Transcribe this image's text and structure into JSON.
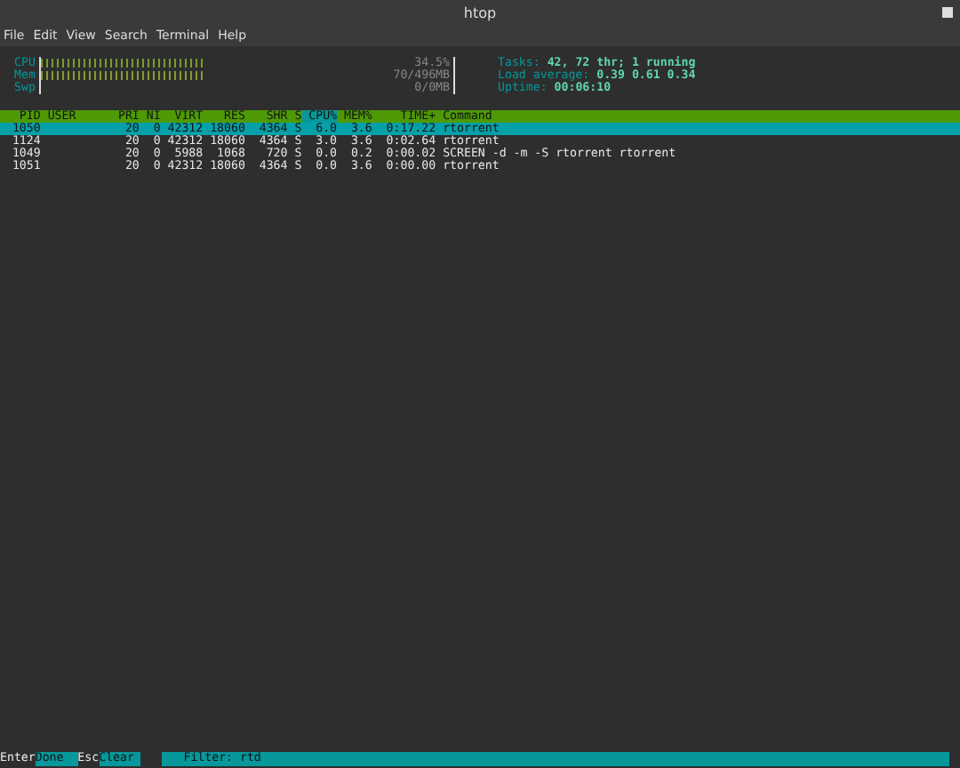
{
  "window": {
    "title": "htop"
  },
  "menu": [
    "File",
    "Edit",
    "View",
    "Search",
    "Terminal",
    "Help"
  ],
  "meters": [
    {
      "label": "CPU",
      "level": 0.4,
      "reading": "34.5%"
    },
    {
      "label": "Mem",
      "level": 0.4,
      "reading": "70/496MB"
    },
    {
      "label": "Swp",
      "reading": "0/0MB"
    }
  ],
  "summary": [
    {
      "label": "Tasks:",
      "value": "42, 72 thr; 1 running"
    },
    {
      "label": "Load average:",
      "value": "0.39 0.61 0.34"
    },
    {
      "label": "Uptime:",
      "value": "00:06:10"
    }
  ],
  "table": {
    "columns": [
      {
        "label": "PID",
        "sorted": false
      },
      {
        "label": "USER",
        "sorted": false
      },
      {
        "label": "PRI",
        "sorted": false
      },
      {
        "label": "NI",
        "sorted": false
      },
      {
        "label": "VIRT",
        "sorted": false
      },
      {
        "label": "RES",
        "sorted": false
      },
      {
        "label": "SHR",
        "sorted": false
      },
      {
        "label": "S",
        "sorted": false
      },
      {
        "label": "CPU%",
        "sorted": true
      },
      {
        "label": "MEM%",
        "sorted": false
      },
      {
        "label": "TIME+",
        "sorted": false
      },
      {
        "label": "Command",
        "sorted": false
      }
    ],
    "rows": [
      {
        "selected": true,
        "cells": [
          "1050",
          "",
          "20",
          "0",
          "42312",
          "18060",
          "4364",
          "S",
          "6.0",
          "3.6",
          "0:17.22",
          "rtorrent"
        ]
      },
      {
        "selected": false,
        "cells": [
          "1124",
          "",
          "20",
          "0",
          "42312",
          "18060",
          "4364",
          "S",
          "3.0",
          "3.6",
          "0:02.64",
          "rtorrent"
        ]
      },
      {
        "selected": false,
        "cells": [
          "1049",
          "",
          "20",
          "0",
          "5988",
          "1068",
          "720",
          "S",
          "0.0",
          "0.2",
          "0:00.02",
          "SCREEN -d -m -S rtorrent rtorrent"
        ]
      },
      {
        "selected": false,
        "cells": [
          "1051",
          "",
          "20",
          "0",
          "42312",
          "18060",
          "4364",
          "S",
          "0.0",
          "3.6",
          "0:00.00",
          "rtorrent"
        ]
      }
    ]
  },
  "footer": {
    "keys": [
      {
        "key": "Enter",
        "action": "Done"
      },
      {
        "key": "Esc",
        "action": "Clear"
      }
    ],
    "filter": "Filter: rtd"
  }
}
